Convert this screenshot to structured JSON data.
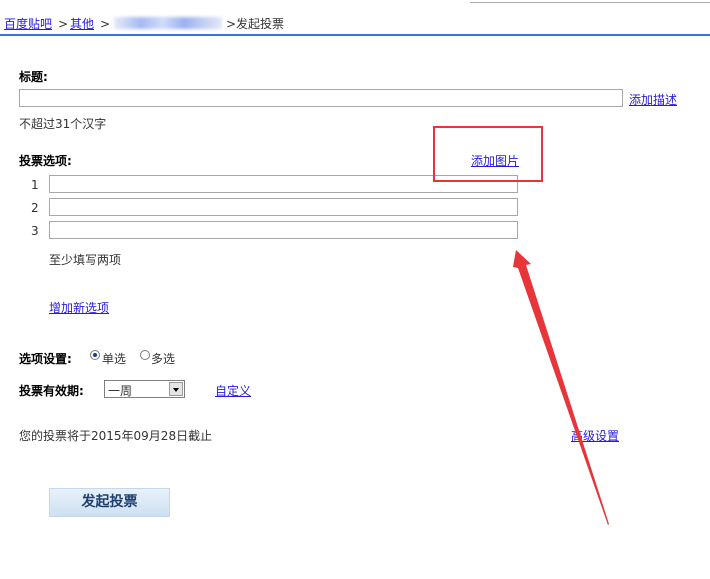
{
  "breadcrumb": {
    "home": "百度贴吧",
    "sep1": ">",
    "category": "其他",
    "sep2": ">",
    "current": ">发起投票"
  },
  "form": {
    "title_label": "标题:",
    "title_value": "",
    "add_description": "添加描述",
    "title_hint": "不超过31个汉字",
    "options_label": "投票选项:",
    "add_image": "添加图片",
    "options": [
      {
        "index": "1",
        "value": ""
      },
      {
        "index": "2",
        "value": ""
      },
      {
        "index": "3",
        "value": ""
      }
    ],
    "options_hint": "至少填写两项",
    "add_option": "增加新选项",
    "choice_label": "选项设置:",
    "choice_single": "单选",
    "choice_multi": "多选",
    "choice_selected": "single",
    "duration_label": "投票有效期:",
    "duration_value": "一周",
    "custom_link": "自定义",
    "deadline_text": "您的投票将于2015年09月28日截止",
    "advanced": "高级设置",
    "submit": "发起投票"
  },
  "annotation": {
    "color": "#e8353a"
  }
}
